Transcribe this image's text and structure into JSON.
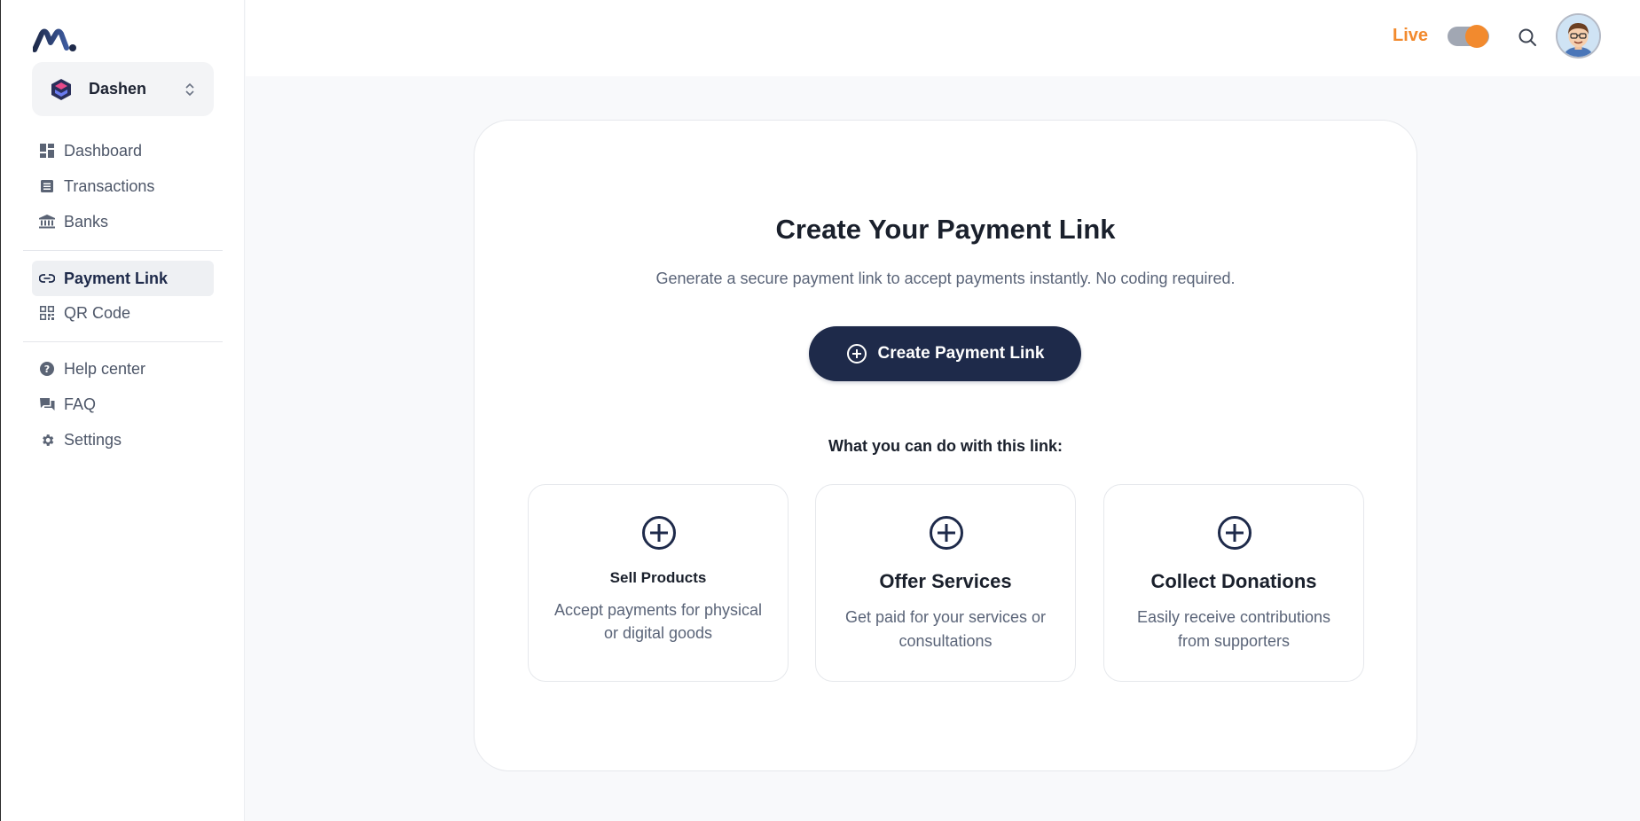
{
  "app": {
    "org_name": "Dashen"
  },
  "sidebar": {
    "group1": [
      {
        "label": "Dashboard",
        "icon": "dashboard-icon"
      },
      {
        "label": "Transactions",
        "icon": "list-icon"
      },
      {
        "label": "Banks",
        "icon": "bank-icon"
      }
    ],
    "group2": [
      {
        "label": "Payment Link",
        "icon": "link-icon",
        "active": true
      },
      {
        "label": "QR Code",
        "icon": "qr-code-icon"
      }
    ],
    "group3": [
      {
        "label": "Help center",
        "icon": "help-icon"
      },
      {
        "label": "FAQ",
        "icon": "chat-icon"
      },
      {
        "label": "Settings",
        "icon": "gear-icon"
      }
    ]
  },
  "topbar": {
    "mode_label": "Live",
    "live_mode_on": true,
    "accent_color": "#f28a2e"
  },
  "main": {
    "title": "Create Your Payment Link",
    "subtitle": "Generate a secure payment link to accept payments instantly. No coding required.",
    "cta_label": "Create Payment Link",
    "section_label": "What you can do with this link:",
    "features": [
      {
        "title": "Sell Products",
        "desc": "Accept payments for physical or digital goods"
      },
      {
        "title": "Offer Services",
        "desc": "Get paid for your services or consultations"
      },
      {
        "title": "Collect Donations",
        "desc": "Easily receive contributions from supporters"
      }
    ]
  },
  "colors": {
    "primary": "#1e2a4a",
    "accent": "#f28a2e",
    "text_muted": "#5a6478"
  }
}
